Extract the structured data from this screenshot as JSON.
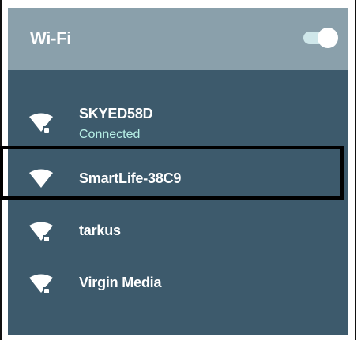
{
  "header": {
    "title": "Wi-Fi",
    "toggle_on": true
  },
  "networks": [
    {
      "name": "SKYED58D",
      "status": "Connected",
      "secured": true
    },
    {
      "name": "SmartLife-38C9",
      "status": "",
      "secured": false
    },
    {
      "name": "tarkus",
      "status": "",
      "secured": true
    },
    {
      "name": "Virgin Media",
      "status": "",
      "secured": true
    }
  ],
  "colors": {
    "panel_bg": "#3d5a6c",
    "header_bg": "#8aa0ab",
    "connected_text": "#b7f0e6",
    "highlight_border": "#000000"
  }
}
